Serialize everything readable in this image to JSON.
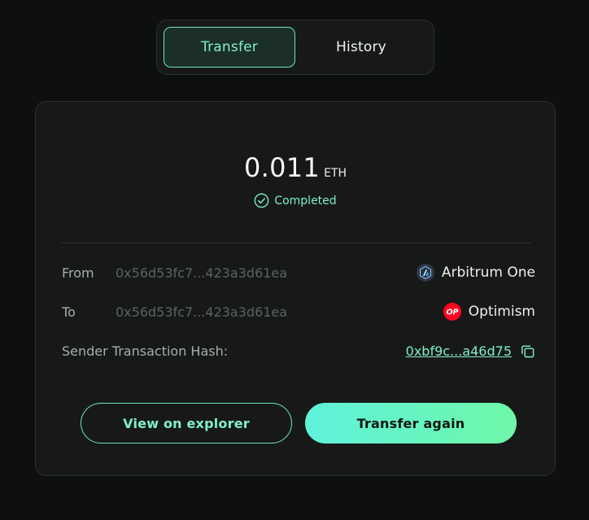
{
  "tabs": [
    {
      "label": "Transfer",
      "active": true
    },
    {
      "label": "History",
      "active": false
    }
  ],
  "transfer": {
    "amount": "0.011",
    "currency": "ETH",
    "status": "Completed"
  },
  "details": {
    "from": {
      "label": "From",
      "address": "0x56d53fc7...423a3d61ea",
      "network": "Arbitrum One",
      "network_icon": "arbitrum-logo"
    },
    "to": {
      "label": "To",
      "address": "0x56d53fc7...423a3d61ea",
      "network": "Optimism",
      "network_icon": "optimism-logo",
      "network_icon_text": "OP"
    },
    "hash": {
      "label": "Sender Transaction Hash:",
      "value": "0xbf9c...a46d75"
    }
  },
  "actions": {
    "explorer_label": "View on explorer",
    "again_label": "Transfer again"
  },
  "colors": {
    "accent": "#7ff0cc",
    "background": "#0e0f0f",
    "card": "#171918",
    "optimism_red": "#ff0420"
  }
}
